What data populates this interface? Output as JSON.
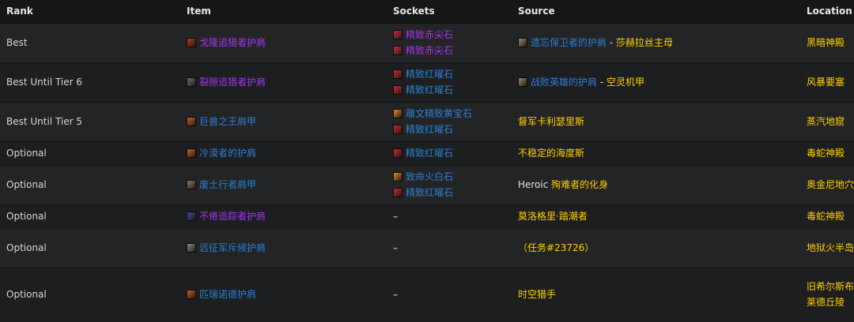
{
  "headers": {
    "rank": "Rank",
    "item": "Item",
    "sockets": "Sockets",
    "source": "Source",
    "location": "Location"
  },
  "rows": [
    {
      "rank": "Best",
      "item": {
        "text": "戈隆追猎者护肩",
        "quality": "epic",
        "icon": "shoulder-icon",
        "color": "#b43c28"
      },
      "sockets": [
        {
          "text": "精致赤尖石",
          "quality": "epic",
          "icon": "red-gem-icon",
          "color": "#d02848"
        },
        {
          "text": "精致赤尖石",
          "quality": "epic",
          "icon": "red-gem-icon",
          "color": "#d02848"
        }
      ],
      "source": {
        "icon": "token-icon",
        "name": "遗忘保卫者的护肩",
        "sep": " - ",
        "boss": "莎赫拉丝主母"
      },
      "location": "黑暗神殿"
    },
    {
      "rank": "Best Until Tier 6",
      "item": {
        "text": "裂隙追猎者护肩",
        "quality": "epic",
        "icon": "shoulder-icon",
        "color": "#6a6e78"
      },
      "sockets": [
        {
          "text": "精致红曜石",
          "quality": "rare",
          "icon": "red-gem-icon",
          "color": "#c82838"
        },
        {
          "text": "精致红曜石",
          "quality": "rare",
          "icon": "red-gem-icon",
          "color": "#c82838"
        }
      ],
      "source": {
        "icon": "token-icon",
        "name": "战败英雄的护肩",
        "sep": " - ",
        "boss": "空灵机甲"
      },
      "location": "风暴要塞"
    },
    {
      "rank": "Best Until Tier 5",
      "item": {
        "text": "巨兽之王肩甲",
        "quality": "rare",
        "icon": "shoulder-icon",
        "color": "#c8641e"
      },
      "sockets": [
        {
          "text": "雕文精致黄宝石",
          "quality": "rare",
          "icon": "orange-gem-icon",
          "color": "#e08a2a"
        },
        {
          "text": "精致红曜石",
          "quality": "rare",
          "icon": "red-gem-icon",
          "color": "#c82838"
        }
      ],
      "source": {
        "boss": "督军卡利瑟里斯"
      },
      "location": "蒸汽地窟"
    },
    {
      "rank": "Optional",
      "item": {
        "text": "冷漠者的护肩",
        "quality": "rare",
        "icon": "shoulder-icon",
        "color": "#c8641e"
      },
      "sockets": [
        {
          "text": "精致红曜石",
          "quality": "rare",
          "icon": "red-gem-icon",
          "color": "#c82838"
        }
      ],
      "source": {
        "boss": "不稳定的海度斯"
      },
      "location": "毒蛇神殿"
    },
    {
      "rank": "Optional",
      "item": {
        "text": "废土行者肩甲",
        "quality": "rare",
        "icon": "shoulder-icon",
        "color": "#8a8070"
      },
      "sockets": [
        {
          "text": "致命火白石",
          "quality": "rare",
          "icon": "orange-gem-icon",
          "color": "#e08a2a"
        },
        {
          "text": "精致红曜石",
          "quality": "rare",
          "icon": "red-gem-icon",
          "color": "#c82838"
        }
      ],
      "source": {
        "prefix": "Heroic ",
        "boss": "殉难者的化身"
      },
      "location": "奥金尼地穴"
    },
    {
      "rank": "Optional",
      "item": {
        "text": "不倦追踪者护肩",
        "quality": "epic",
        "icon": "shoulder-icon",
        "color": "#3a4aa0"
      },
      "sockets": [],
      "dash": "–",
      "source": {
        "boss": "莫洛格里·踏潮者"
      },
      "location": "毒蛇神殿"
    },
    {
      "rank": "Optional",
      "item": {
        "text": "远征军斥候护肩",
        "quality": "rare",
        "icon": "shoulder-icon",
        "color": "#8a8a8a"
      },
      "sockets": [],
      "dash": "–",
      "source": {
        "boss": "（任务#23726）"
      },
      "location": "地狱火半岛"
    },
    {
      "rank": "Optional",
      "item": {
        "text": "匹瑞诺德护肩",
        "quality": "rare",
        "icon": "shoulder-icon",
        "color": "#c85a1e"
      },
      "sockets": [],
      "dash": "–",
      "source": {
        "boss": "时空猎手"
      },
      "location": "旧希尔斯布莱德丘陵"
    }
  ]
}
